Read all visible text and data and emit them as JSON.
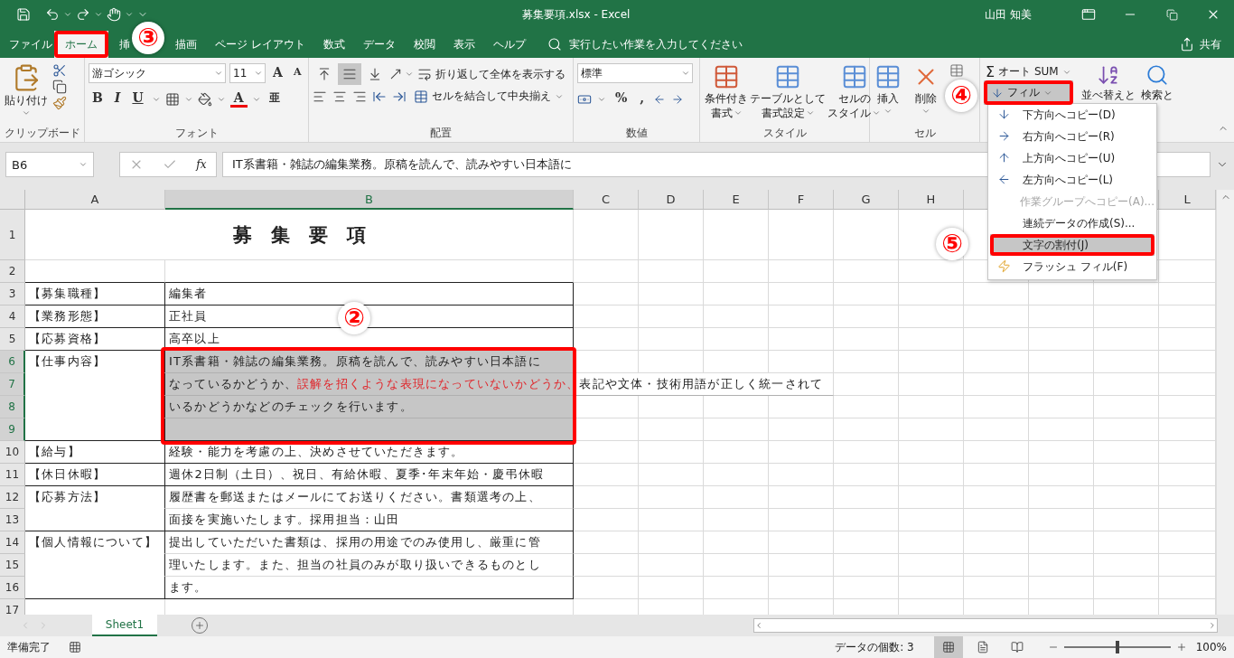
{
  "window": {
    "title": "募集要項.xlsx  -  Excel",
    "user": "山田 知美"
  },
  "menu_tabs": [
    {
      "label": "ファイル",
      "selected": false,
      "highlighted": false
    },
    {
      "label": "ホーム",
      "selected": true,
      "highlighted": true
    },
    {
      "label": "挿",
      "selected": false,
      "highlighted": false
    },
    {
      "label": "描画",
      "selected": false,
      "highlighted": false
    },
    {
      "label": "ページ レイアウト",
      "selected": false,
      "highlighted": false
    },
    {
      "label": "数式",
      "selected": false,
      "highlighted": false
    },
    {
      "label": "データ",
      "selected": false,
      "highlighted": false
    },
    {
      "label": "校閲",
      "selected": false,
      "highlighted": false
    },
    {
      "label": "表示",
      "selected": false,
      "highlighted": false
    },
    {
      "label": "ヘルプ",
      "selected": false,
      "highlighted": false
    }
  ],
  "tell_me": {
    "placeholder": "実行したい作業を入力してください"
  },
  "share": "共有",
  "ribbon": {
    "clipboard": {
      "paste": "貼り付け",
      "label": "クリップボード"
    },
    "font": {
      "name": "游ゴシック",
      "size": "11",
      "grow": "A",
      "shrink": "A",
      "bold": "B",
      "italic": "I",
      "underline": "U",
      "color_glyph": "A",
      "phonetic": "亜",
      "label": "フォント"
    },
    "alignment": {
      "valign": [
        {
          "kind": "top",
          "selected": false
        },
        {
          "kind": "middle",
          "selected": true
        },
        {
          "kind": "bottom",
          "selected": false
        }
      ],
      "wrap": "折り返して全体を表示する",
      "merge": "セルを結合して中央揃え",
      "label": "配置"
    },
    "number": {
      "format": "標準",
      "percent": "%",
      "comma": ",",
      "label": "数値"
    },
    "styles": {
      "buttons": [
        {
          "lines": [
            "条件付き",
            "書式"
          ]
        },
        {
          "lines": [
            "テーブルとして",
            "書式設定"
          ]
        },
        {
          "lines": [
            "セルの",
            "スタイル"
          ]
        }
      ],
      "label": "スタイル"
    },
    "cells": {
      "buttons": [
        {
          "kind": "insert",
          "label": "挿入"
        },
        {
          "kind": "delete",
          "label": "削除"
        },
        {
          "kind": "format"
        }
      ],
      "label": "セル"
    },
    "editing": {
      "sigma": "Σ",
      "autosum": "オート SUM",
      "fill": {
        "label": "フィル",
        "selected": true,
        "highlighted": true
      },
      "sort": "並べ替えと",
      "find": "検索と"
    }
  },
  "formula_bar": {
    "name_box": "B6",
    "fx": "fx",
    "formula": "IT系書籍・雑誌の編集業務。原稿を読んで、読みやすい日本語に"
  },
  "columns": [
    {
      "label": "A",
      "selected": false
    },
    {
      "label": "B",
      "selected": true
    },
    {
      "label": "C",
      "selected": false
    },
    {
      "label": "D",
      "selected": false
    },
    {
      "label": "E",
      "selected": false
    },
    {
      "label": "F",
      "selected": false
    },
    {
      "label": "G",
      "selected": false
    },
    {
      "label": "H",
      "selected": false
    },
    {},
    {},
    {},
    {
      "label": "L",
      "selected": false
    }
  ],
  "rows": [
    {
      "number": "1",
      "selected": false,
      "title": "募　集　要　項"
    },
    {
      "number": "2",
      "selected": false
    },
    {
      "number": "3",
      "selected": false,
      "a": "【募集職種】",
      "b": "編集者"
    },
    {
      "number": "4",
      "selected": false,
      "a": "【業務形態】",
      "b": "正社員"
    },
    {
      "number": "5",
      "selected": false,
      "a": "【応募資格】",
      "b": "高卒以上"
    },
    {
      "number": "6",
      "selected": true,
      "a": "【仕事内容】",
      "b": "IT系書籍・雑誌の編集業務。原稿を読んで、読みやすい日本語に"
    },
    {
      "number": "7",
      "selected": true,
      "b_runs": [
        {
          "text": "なっているかどうか、",
          "emphasis": false
        },
        {
          "text": "誤解を招くような表現になっていないかどうか、",
          "emphasis": true
        },
        {
          "text": "表記や文体・技術用語が正しく統一されて",
          "emphasis": false
        }
      ]
    },
    {
      "number": "8",
      "selected": true,
      "b": "いるかどうかなどのチェックを行います。"
    },
    {
      "number": "9",
      "selected": true,
      "b": ""
    },
    {
      "number": "10",
      "selected": false,
      "a": "【給与】",
      "b": "経験・能力を考慮の上、決めさせていただきます。"
    },
    {
      "number": "11",
      "selected": false,
      "a": "【休日休暇】",
      "b": "週休2日制（土日）、祝日、有給休暇、夏季･年末年始・慶弔休暇"
    },
    {
      "number": "12",
      "selected": false,
      "a": "【応募方法】",
      "b": "履歴書を郵送またはメールにてお送りください。書類選考の上、"
    },
    {
      "number": "13",
      "selected": false,
      "b": "面接を実施いたします。採用担当：山田"
    },
    {
      "number": "14",
      "selected": false,
      "a": "【個人情報について】",
      "b": "提出していただいた書類は、採用の用途でのみ使用し、厳重に管"
    },
    {
      "number": "15",
      "selected": false,
      "b": "理いたします。また、担当の社員のみが取り扱いできるものとし"
    },
    {
      "number": "16",
      "selected": false,
      "b": "ます。"
    },
    {
      "number": "17",
      "selected": false
    }
  ],
  "fill_menu": {
    "items": [
      {
        "label": "下方向へコピー(D)",
        "kind": "down",
        "disabled": false,
        "selected": false,
        "highlighted": false
      },
      {
        "label": "右方向へコピー(R)",
        "kind": "right",
        "disabled": false,
        "selected": false,
        "highlighted": false
      },
      {
        "label": "上方向へコピー(U)",
        "kind": "up",
        "disabled": false,
        "selected": false,
        "highlighted": false
      },
      {
        "label": "左方向へコピー(L)",
        "kind": "left",
        "disabled": false,
        "selected": false,
        "highlighted": false
      },
      {
        "label": "作業グループへコピー(A)...",
        "kind": "plain",
        "disabled": true,
        "selected": false,
        "highlighted": false
      },
      {
        "label": "連続データの作成(S)...",
        "kind": "plain",
        "disabled": false,
        "selected": false,
        "highlighted": false
      },
      {
        "label": "文字の割付(J)",
        "kind": "plain",
        "disabled": false,
        "selected": true,
        "highlighted": true
      },
      {
        "label": "フラッシュ フィル(F)",
        "kind": "flash",
        "disabled": false,
        "selected": false,
        "highlighted": false
      }
    ]
  },
  "callouts": [
    {
      "label": "③"
    },
    {
      "label": "②"
    },
    {
      "label": "④"
    },
    {
      "label": "⑤"
    }
  ],
  "sheet_tabs": [
    {
      "label": "Sheet1",
      "selected": true
    }
  ],
  "status_bar": {
    "ready": "準備完了",
    "count": "データの個数: 3",
    "views": [
      {
        "kind": "normal",
        "selected": true
      },
      {
        "kind": "layout",
        "selected": false
      },
      {
        "kind": "break",
        "selected": false
      }
    ],
    "zoom": {
      "level": 0.5,
      "reading": "100%"
    }
  }
}
